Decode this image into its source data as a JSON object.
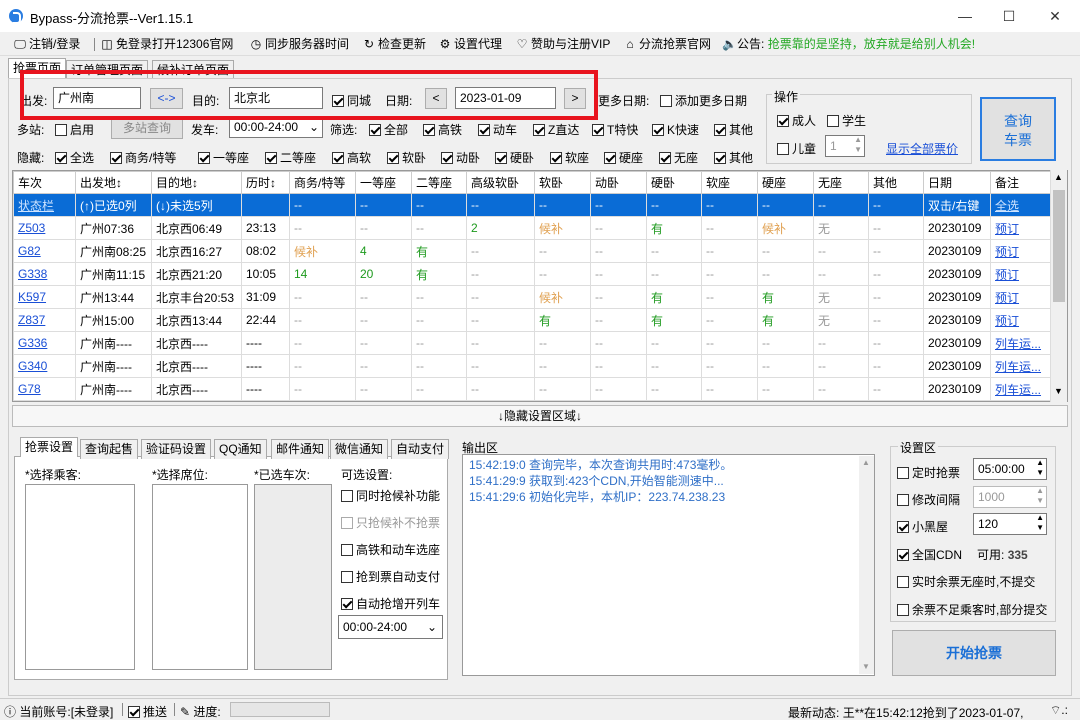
{
  "window": {
    "title": "Bypass-分流抢票--Ver1.15.1",
    "minimize": "—",
    "maximize": "☐",
    "close": "✕"
  },
  "menu": {
    "items": [
      {
        "label": "注销/登录",
        "icon": "🖵"
      },
      {
        "label": "免登录打开12306官网",
        "icon": "◫"
      },
      {
        "label": "同步服务器时间",
        "icon": "◷"
      },
      {
        "label": "检查更新",
        "icon": "↻"
      },
      {
        "label": "设置代理",
        "icon": "⚙"
      },
      {
        "label": "赞助与注册VIP",
        "icon": "♡"
      },
      {
        "label": "分流抢票官网",
        "icon": "⌂"
      }
    ],
    "notice_label": "公告:",
    "notice_text": "抢票靠的是坚持，放弃就是给别人机会!"
  },
  "top_tabs": [
    "抢票页面",
    "订单管理页面",
    "候补订单页面"
  ],
  "search": {
    "from_label": "出发:",
    "from_value": "广州南",
    "swap_label": "<->",
    "to_label": "目的:",
    "to_value": "北京北",
    "same_city_label": "同城",
    "date_label": "日期:",
    "date_value": "2023-01-09",
    "prev": "<",
    "next": ">",
    "more_dates_label": "更多日期:",
    "add_more_dates_label": "添加更多日期",
    "multi_station_label": "多站:",
    "enable_label": "启用",
    "multi_query_button": "多站查询",
    "depart_label": "发车:",
    "depart_value": "00:00-24:00",
    "filter_label": "筛选:",
    "filters": [
      "全部",
      "高铁",
      "动车",
      "Z直达",
      "T特快",
      "K快速",
      "其他"
    ],
    "hide_label": "隐藏:",
    "hide_options": [
      "全选",
      "商务/特等",
      "一等座",
      "二等座",
      "高软",
      "软卧",
      "动卧",
      "硬卧",
      "软座",
      "硬座",
      "无座",
      "其他"
    ]
  },
  "operation": {
    "group_label": "操作",
    "adult_label": "成人",
    "student_label": "学生",
    "child_label": "儿童",
    "child_count": "1",
    "show_prices_link": "显示全部票价",
    "query_button_line1": "查询",
    "query_button_line2": "车票"
  },
  "table": {
    "headers": [
      "车次",
      "出发地↕",
      "目的地↕",
      "历时↕",
      "商务/特等",
      "一等座",
      "二等座",
      "高级软卧",
      "软卧",
      "动卧",
      "硬卧",
      "软座",
      "硬座",
      "无座",
      "其他",
      "日期",
      "备注"
    ],
    "rows": [
      [
        "状态栏",
        "(↑)已选0列",
        "(↓)未选5列",
        "",
        "--",
        "--",
        "--",
        "--",
        "--",
        "--",
        "--",
        "--",
        "--",
        "--",
        "--",
        "双击/右键",
        "全选"
      ],
      [
        "Z503",
        "广州07:36",
        "北京西06:49",
        "23:13",
        "--",
        "--",
        "--",
        "2",
        "候补",
        "--",
        "有",
        "--",
        "候补",
        "无",
        "--",
        "20230109",
        "预订"
      ],
      [
        "G82",
        "广州南08:25",
        "北京西16:27",
        "08:02",
        "候补",
        "4",
        "有",
        "--",
        "--",
        "--",
        "--",
        "--",
        "--",
        "--",
        "--",
        "20230109",
        "预订"
      ],
      [
        "G338",
        "广州南11:15",
        "北京西21:20",
        "10:05",
        "14",
        "20",
        "有",
        "--",
        "--",
        "--",
        "--",
        "--",
        "--",
        "--",
        "--",
        "20230109",
        "预订"
      ],
      [
        "K597",
        "广州13:44",
        "北京丰台20:53",
        "31:09",
        "--",
        "--",
        "--",
        "--",
        "候补",
        "--",
        "有",
        "--",
        "有",
        "无",
        "--",
        "20230109",
        "预订"
      ],
      [
        "Z837",
        "广州15:00",
        "北京西13:44",
        "22:44",
        "--",
        "--",
        "--",
        "--",
        "有",
        "--",
        "有",
        "--",
        "有",
        "无",
        "--",
        "20230109",
        "预订"
      ],
      [
        "G336",
        "广州南----",
        "北京西----",
        "----",
        "--",
        "--",
        "--",
        "--",
        "--",
        "--",
        "--",
        "--",
        "--",
        "--",
        "--",
        "20230109",
        "列车运..."
      ],
      [
        "G340",
        "广州南----",
        "北京西----",
        "----",
        "--",
        "--",
        "--",
        "--",
        "--",
        "--",
        "--",
        "--",
        "--",
        "--",
        "--",
        "20230109",
        "列车运..."
      ],
      [
        "G78",
        "广州南----",
        "北京西----",
        "----",
        "--",
        "--",
        "--",
        "--",
        "--",
        "--",
        "--",
        "--",
        "--",
        "--",
        "--",
        "20230109",
        "列车运..."
      ]
    ]
  },
  "hide_settings_bar": "↓隐藏设置区域↓",
  "settings_tabs": [
    "抢票设置",
    "查询起售",
    "验证码设置",
    "QQ通知",
    "邮件通知",
    "微信通知",
    "自动支付"
  ],
  "grab_settings": {
    "passenger_label": "*选择乘客:",
    "seat_label": "*选择席位:",
    "train_label": "*已选车次:",
    "options_label": "可选设置:",
    "options": [
      {
        "label": "同时抢候补功能",
        "checked": false,
        "disabled": false
      },
      {
        "label": "只抢候补不抢票",
        "checked": false,
        "disabled": true
      },
      {
        "label": "高铁和动车选座",
        "checked": false,
        "disabled": false
      },
      {
        "label": "抢到票自动支付",
        "checked": false,
        "disabled": false
      },
      {
        "label": "自动抢增开列车",
        "checked": true,
        "disabled": false
      }
    ],
    "time_range": "00:00-24:00"
  },
  "output": {
    "label": "输出区",
    "lines": [
      "15:42:19:0  查询完毕，本次查询共用时:473毫秒。",
      "15:41:29:9  获取到:423个CDN,开始智能测速中...",
      "15:41:29:6  初始化完毕，本机IP：223.74.238.23"
    ]
  },
  "settings_area": {
    "label": "设置区",
    "timed_label": "定时抢票",
    "timed_value": "05:00:00",
    "interval_label": "修改间隔",
    "interval_value": "1000",
    "blackroom_label": "小黑屋",
    "blackroom_value": "120",
    "cdn_label": "全国CDN",
    "cdn_available_label": "可用:",
    "cdn_available_value": "335",
    "realtime_label": "实时余票无座时,不提交",
    "partial_label": "余票不足乘客时,部分提交",
    "start_button": "开始抢票"
  },
  "status": {
    "account_label": "当前账号:",
    "account_value": "[未登录]",
    "push_label": "推送",
    "progress_label": "进度:",
    "latest_label": "最新动态:",
    "latest_value": "王**在15:42:12抢到了2023-01-07,",
    "colors": {
      "accent": "#0a6cd6",
      "green": "#1e9a1e",
      "orange": "#e0a050",
      "link": "#1a4fd6",
      "notice": "#23a823",
      "highlight": "#e8141e"
    }
  }
}
